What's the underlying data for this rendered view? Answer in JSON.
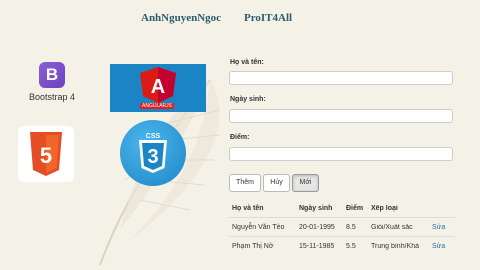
{
  "header": {
    "brand_name": "AnhNguyenNgoc",
    "site_name": "ProIT4All"
  },
  "logos": {
    "bootstrap": {
      "icon_letter": "B",
      "caption": "Bootstrap 4"
    },
    "angular": {
      "icon_letter": "A",
      "caption": "ANGULARJS"
    },
    "html5": {
      "icon_name": "html5-icon",
      "number": "5"
    },
    "css3": {
      "icon_name": "css3-icon",
      "number": "3",
      "label": "CSS"
    }
  },
  "form": {
    "name_label": "Họ và tên:",
    "name_value": "",
    "dob_label": "Ngày sinh:",
    "dob_value": "",
    "score_label": "Điểm:",
    "score_value": ""
  },
  "buttons": {
    "add": "Thêm",
    "cancel": "Hủy",
    "new": "Mới"
  },
  "table": {
    "columns": [
      "Họ và tên",
      "Ngày sinh",
      "Điểm",
      "Xếp loại",
      ""
    ],
    "rows": [
      {
        "name": "Nguyễn Văn Tèo",
        "dob": "20-01-1995",
        "score": "8.5",
        "rank": "Giỏi/Xuất sắc",
        "action": "Sửa"
      },
      {
        "name": "Phạm Thị Nở",
        "dob": "15-11-1985",
        "score": "5.5",
        "rank": "Trung bình/Khá",
        "action": "Sửa"
      }
    ]
  },
  "colors": {
    "background": "#f4f1e6",
    "angular_blue": "#1b84c4",
    "angular_red": "#dd1b16",
    "html5_orange": "#e44d26",
    "css3_blue": "#1b86c6",
    "bootstrap_purple": "#7952b3",
    "link": "#2a6fb8"
  }
}
